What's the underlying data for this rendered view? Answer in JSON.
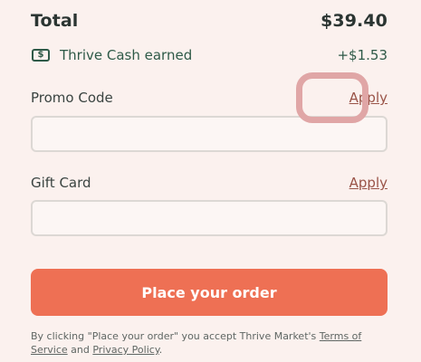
{
  "summary": {
    "total_label": "Total",
    "total_value": "$39.40",
    "cash_label": "Thrive Cash earned",
    "cash_value": "+$1.53",
    "cash_icon": "dollar-bill-icon"
  },
  "promo": {
    "label": "Promo Code",
    "apply_label": "Apply",
    "value": "",
    "placeholder": ""
  },
  "gift_card": {
    "label": "Gift Card",
    "apply_label": "Apply",
    "value": "",
    "placeholder": ""
  },
  "checkout": {
    "button_label": "Place your order"
  },
  "legal": {
    "prefix": "By clicking \"Place your order\" you accept Thrive Market's ",
    "terms_label": "Terms of Service",
    "and": " and ",
    "privacy_label": "Privacy Policy",
    "suffix": "."
  },
  "colors": {
    "background": "#fbf1ee",
    "accent": "#ee7054",
    "link": "#9a5448",
    "cash_green": "#2f5a48",
    "highlight": "#e0a6a6"
  }
}
